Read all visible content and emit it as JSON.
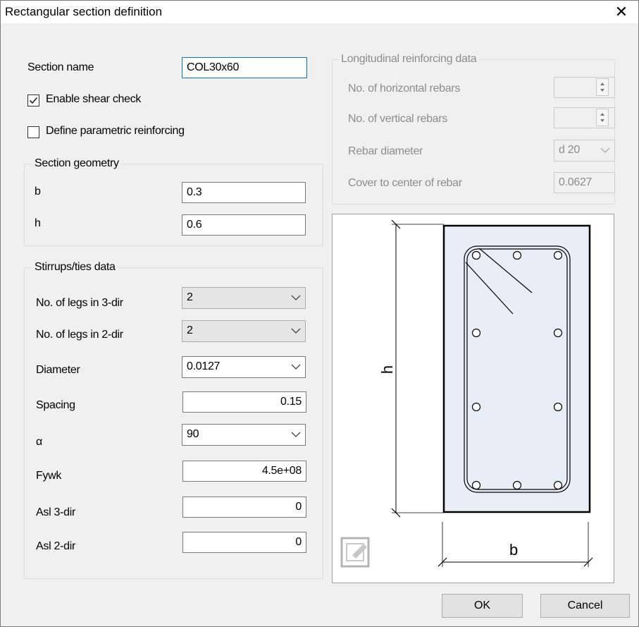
{
  "window": {
    "title": "Rectangular section definition",
    "close_glyph": "✕"
  },
  "section_name": {
    "label": "Section name",
    "value": "COL30x60"
  },
  "enable_shear_check": {
    "label": "Enable shear check",
    "checked": true
  },
  "define_parametric": {
    "label": "Define parametric reinforcing",
    "checked": false
  },
  "geometry": {
    "title": "Section geometry",
    "b_label": "b",
    "b_value": "0.3",
    "h_label": "h",
    "h_value": "0.6"
  },
  "stirrups": {
    "title": "Stirrups/ties  data",
    "legs3_label": "No. of legs in 3-dir",
    "legs3_value": "2",
    "legs2_label": "No. of legs in 2-dir",
    "legs2_value": "2",
    "diameter_label": "Diameter",
    "diameter_value": "0.0127",
    "spacing_label": "Spacing",
    "spacing_value": "0.15",
    "alpha_label": "α",
    "alpha_value": "90",
    "fywk_label": "Fywk",
    "fywk_value": "4.5e+08",
    "asl3_label": "Asl 3-dir",
    "asl3_value": "0",
    "asl2_label": "Asl 2-dir",
    "asl2_value": "0"
  },
  "longitudinal": {
    "title": "Longitudinal reinforcing data",
    "hrebars_label": "No. of horizontal rebars",
    "hrebars_value": "",
    "vrebars_label": "No. of vertical rebars",
    "vrebars_value": "",
    "diameter_label": "Rebar diameter",
    "diameter_value": "d 20",
    "cover_label": "Cover to center of rebar",
    "cover_value": "0.0627"
  },
  "drawing": {
    "h_label": "h",
    "b_label": "b",
    "section_fill": "#e8eef8"
  },
  "buttons": {
    "ok": "OK",
    "cancel": "Cancel"
  },
  "colors": {
    "accent": "#0078d7",
    "disabled_text": "#8d8d8d"
  },
  "icons": {
    "edit": "edit-drawing-icon",
    "close": "close-icon",
    "chevron": "chevron-down-icon",
    "spinner": "spinner-icon"
  }
}
